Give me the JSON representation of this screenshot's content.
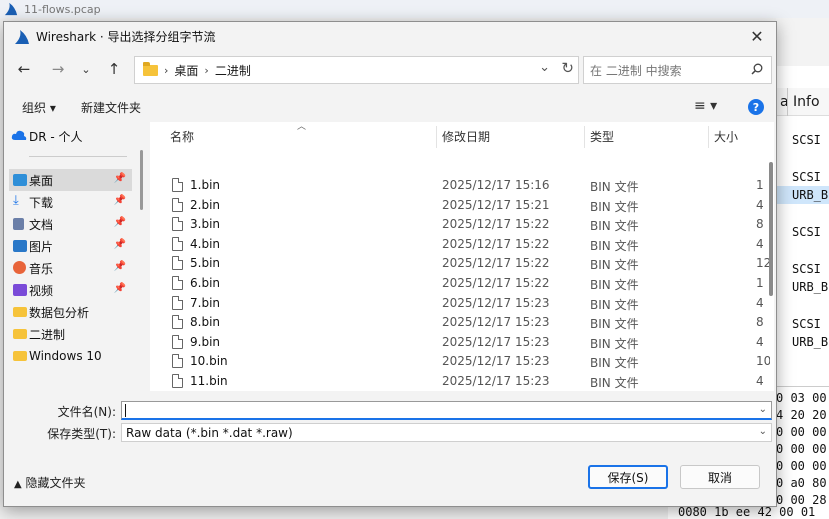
{
  "background": {
    "window_title": "11-flows.pcap",
    "packet_list_header": "a Info",
    "packet_lines": [
      "SCSI",
      "SCSI",
      "URB_B",
      "SCSI",
      "SCSI",
      "URB_B",
      "SCSI",
      "URB_B"
    ],
    "hex_lines": [
      "0 03 00",
      "4 20 20",
      "0 00 00",
      "0 00 00",
      "0 00 00",
      "0 a0 80",
      "0 00 28"
    ],
    "hex_bottom": "0080  1b ee 42 00 01"
  },
  "dialog": {
    "title": "Wireshark · 导出选择分组字节流",
    "address": {
      "crumbs": [
        "桌面",
        "二进制"
      ]
    },
    "search_placeholder": "在 二进制 中搜索",
    "toolbar": {
      "organize": "组织 ▾",
      "new_folder": "新建文件夹"
    },
    "sidebar": {
      "top_item": "DR - 个人",
      "items": [
        {
          "label": "桌面",
          "pinned": true,
          "color": "#2f8fd8"
        },
        {
          "label": "下载",
          "pinned": true,
          "color": "#1a73e8"
        },
        {
          "label": "文档",
          "pinned": true,
          "color": "#6b7fa8"
        },
        {
          "label": "图片",
          "pinned": true,
          "color": "#2a78c8"
        },
        {
          "label": "音乐",
          "pinned": true,
          "color": "#e8643a"
        },
        {
          "label": "视频",
          "pinned": true,
          "color": "#7a4bd8"
        },
        {
          "label": "数据包分析",
          "pinned": false,
          "color": "#f6c33a"
        },
        {
          "label": "二进制",
          "pinned": false,
          "color": "#f6c33a"
        },
        {
          "label": "Windows 10",
          "pinned": false,
          "color": "#f6c33a"
        }
      ]
    },
    "columns": {
      "name": "名称",
      "modified": "修改日期",
      "type": "类型",
      "size": "大小"
    },
    "files": [
      {
        "name": "1.bin",
        "date": "2025/12/17 15:16",
        "type": "BIN 文件",
        "size": "1"
      },
      {
        "name": "2.bin",
        "date": "2025/12/17 15:21",
        "type": "BIN 文件",
        "size": "4"
      },
      {
        "name": "3.bin",
        "date": "2025/12/17 15:22",
        "type": "BIN 文件",
        "size": "8"
      },
      {
        "name": "4.bin",
        "date": "2025/12/17 15:22",
        "type": "BIN 文件",
        "size": "4"
      },
      {
        "name": "5.bin",
        "date": "2025/12/17 15:22",
        "type": "BIN 文件",
        "size": "12"
      },
      {
        "name": "6.bin",
        "date": "2025/12/17 15:22",
        "type": "BIN 文件",
        "size": "1"
      },
      {
        "name": "7.bin",
        "date": "2025/12/17 15:23",
        "type": "BIN 文件",
        "size": "4"
      },
      {
        "name": "8.bin",
        "date": "2025/12/17 15:23",
        "type": "BIN 文件",
        "size": "8"
      },
      {
        "name": "9.bin",
        "date": "2025/12/17 15:23",
        "type": "BIN 文件",
        "size": "4"
      },
      {
        "name": "10.bin",
        "date": "2025/12/17 15:23",
        "type": "BIN 文件",
        "size": "10"
      },
      {
        "name": "11.bin",
        "date": "2025/12/17 15:23",
        "type": "BIN 文件",
        "size": "4"
      }
    ],
    "form": {
      "filename_label": "文件名(N):",
      "filename_value": "",
      "savetype_label": "保存类型(T):",
      "savetype_value": "Raw data (*.bin *.dat *.raw)"
    },
    "footer": {
      "hide_folders": "隐藏文件夹",
      "save": "保存(S)",
      "cancel": "取消"
    }
  }
}
